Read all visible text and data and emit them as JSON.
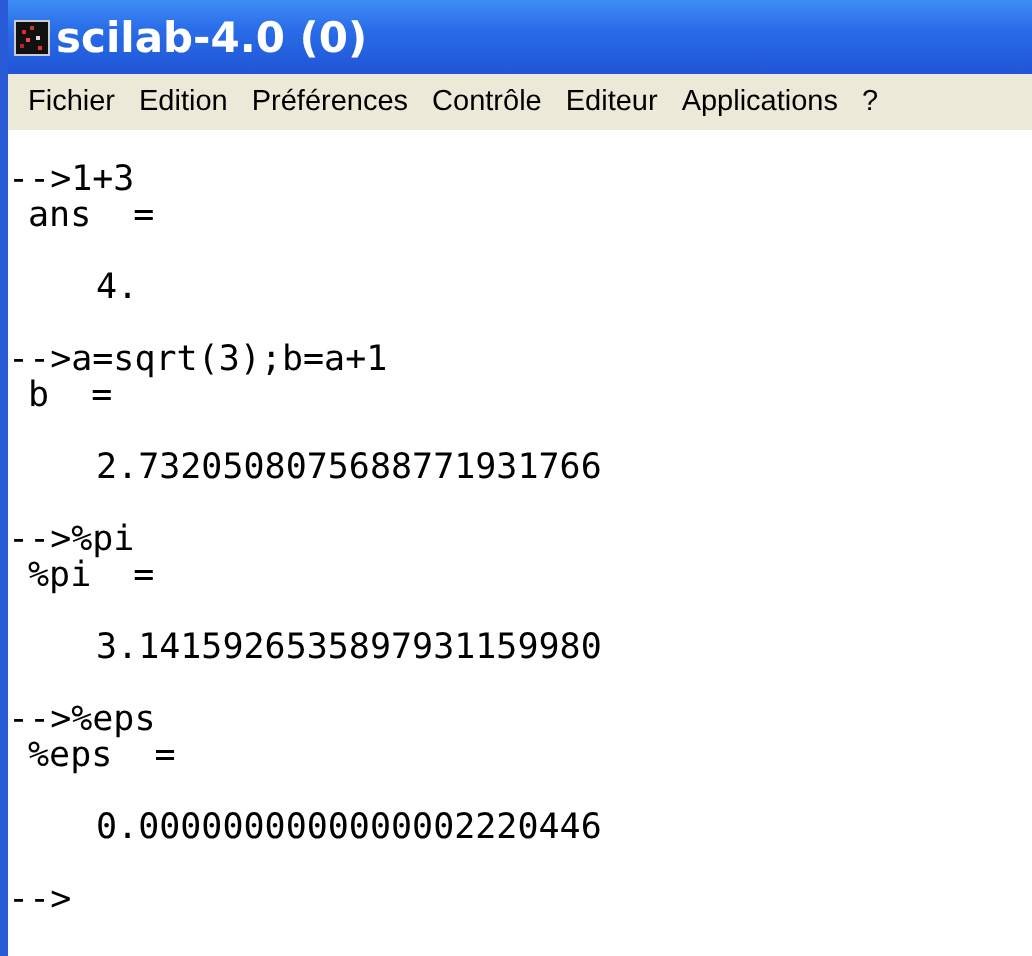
{
  "window": {
    "title": "scilab-4.0 (0)"
  },
  "menu": [
    "Fichier",
    "Edition",
    "Préférences",
    "Contrôle",
    "Editeur",
    "Applications",
    "?"
  ],
  "console": {
    "entries": [
      {
        "command": "-->1+3",
        "variable": "ans  =",
        "value": "4."
      },
      {
        "command": "-->a=sqrt(3);b=a+1",
        "variable": "b  =",
        "value": "2.7320508075688771931766"
      },
      {
        "command": "-->%pi",
        "variable": "%pi  =",
        "value": "3.1415926535897931159980"
      },
      {
        "command": "-->%eps",
        "variable": "%eps  =",
        "value": "0.0000000000000002220446"
      }
    ],
    "prompt": "-->"
  }
}
